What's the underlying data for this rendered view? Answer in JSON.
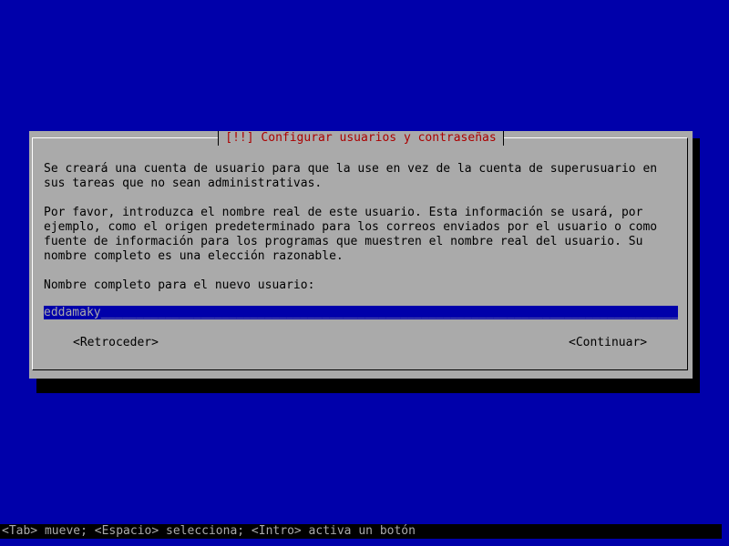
{
  "dialog": {
    "title": "[!!] Configurar usuarios y contraseñas",
    "paragraph_1": "Se creará una cuenta de usuario para que la use en vez de la cuenta de superusuario en\nsus tareas que no sean administrativas.",
    "paragraph_2": "Por favor, introduzca el nombre real de este usuario. Esta información se usará, por\nejemplo, como el origen predeterminado para los correos enviados por el usuario o como\nfuente de información para los programas que muestren el nombre real del usuario. Su\nnombre completo es una elección razonable.",
    "field_label": "Nombre completo para el nuevo usuario:",
    "field_value": "eddamaky",
    "back_button": "<Retroceder>",
    "continue_button": "<Continuar>"
  },
  "status_bar": {
    "text": "<Tab> mueve; <Espacio> selecciona; <Intro> activa un botón"
  },
  "colors": {
    "background": "#0000aa",
    "dialog": "#aaaaaa",
    "title": "#aa0000",
    "input": "#0000aa"
  }
}
